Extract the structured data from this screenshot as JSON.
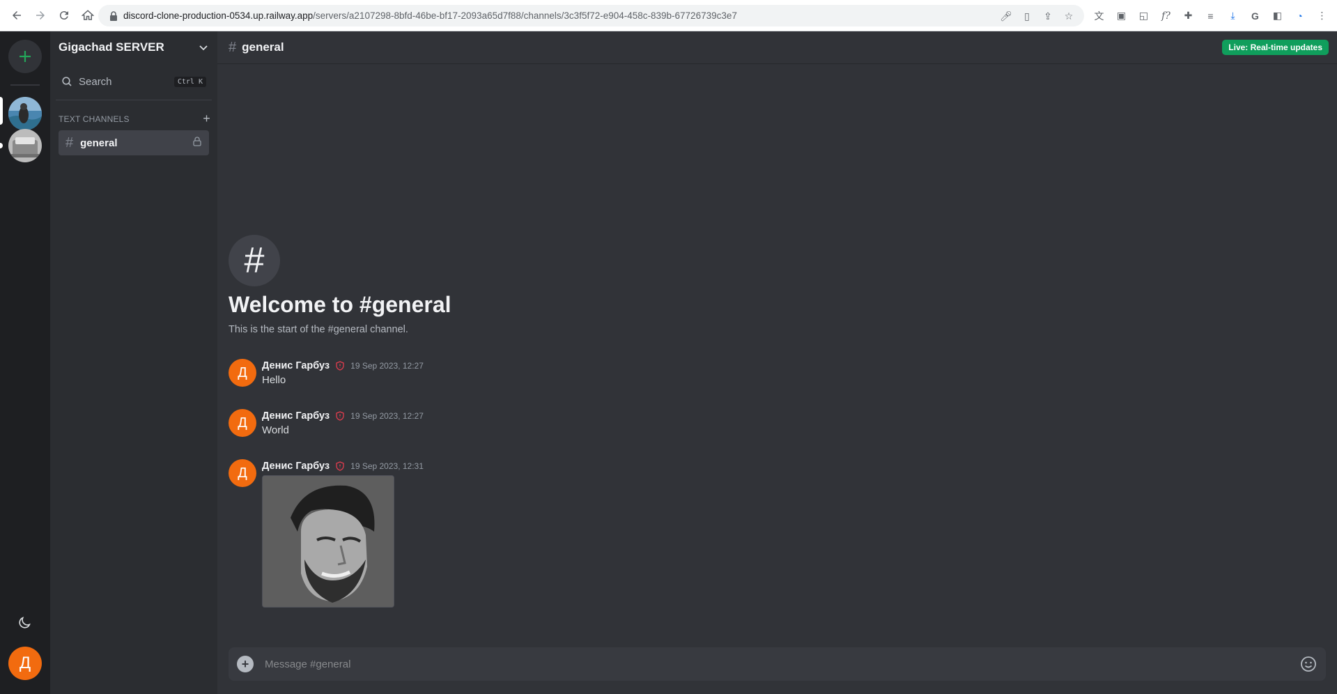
{
  "browser": {
    "url_host": "discord-clone-production-0534.up.railway.app",
    "url_path": "/servers/a2107298-8bfd-46be-bf17-2093a65d7f88/channels/3c3f5f72-e904-458c-839b-67726739c3e7"
  },
  "rail": {
    "add_server_icon": "plus-icon",
    "theme_icon": "moon-icon",
    "user_avatar_initial": "Д"
  },
  "sidebar": {
    "server_name": "Gigachad SERVER",
    "search_label": "Search",
    "search_shortcut": "Ctrl K",
    "category_label": "TEXT CHANNELS",
    "channels": [
      {
        "name": "general",
        "active": true,
        "locked": true
      }
    ]
  },
  "header": {
    "channel_name": "general",
    "live_badge": "Live: Real-time updates"
  },
  "welcome": {
    "title": "Welcome to #general",
    "subtitle": "This is the start of the #general channel."
  },
  "messages": [
    {
      "avatar_initial": "Д",
      "author": "Денис Гарбуз",
      "time": "19 Sep 2023, 12:27",
      "text": "Hello"
    },
    {
      "avatar_initial": "Д",
      "author": "Денис Гарбуз",
      "time": "19 Sep 2023, 12:27",
      "text": "World"
    },
    {
      "avatar_initial": "Д",
      "author": "Денис Гарбуз",
      "time": "19 Sep 2023, 12:31",
      "text": "",
      "has_image": true
    }
  ],
  "composer": {
    "placeholder": "Message #general"
  },
  "colors": {
    "accent_green": "#23a559",
    "live_badge": "#109e5c",
    "avatar_orange": "#f26b0f",
    "admin_badge": "#e23c4e"
  }
}
